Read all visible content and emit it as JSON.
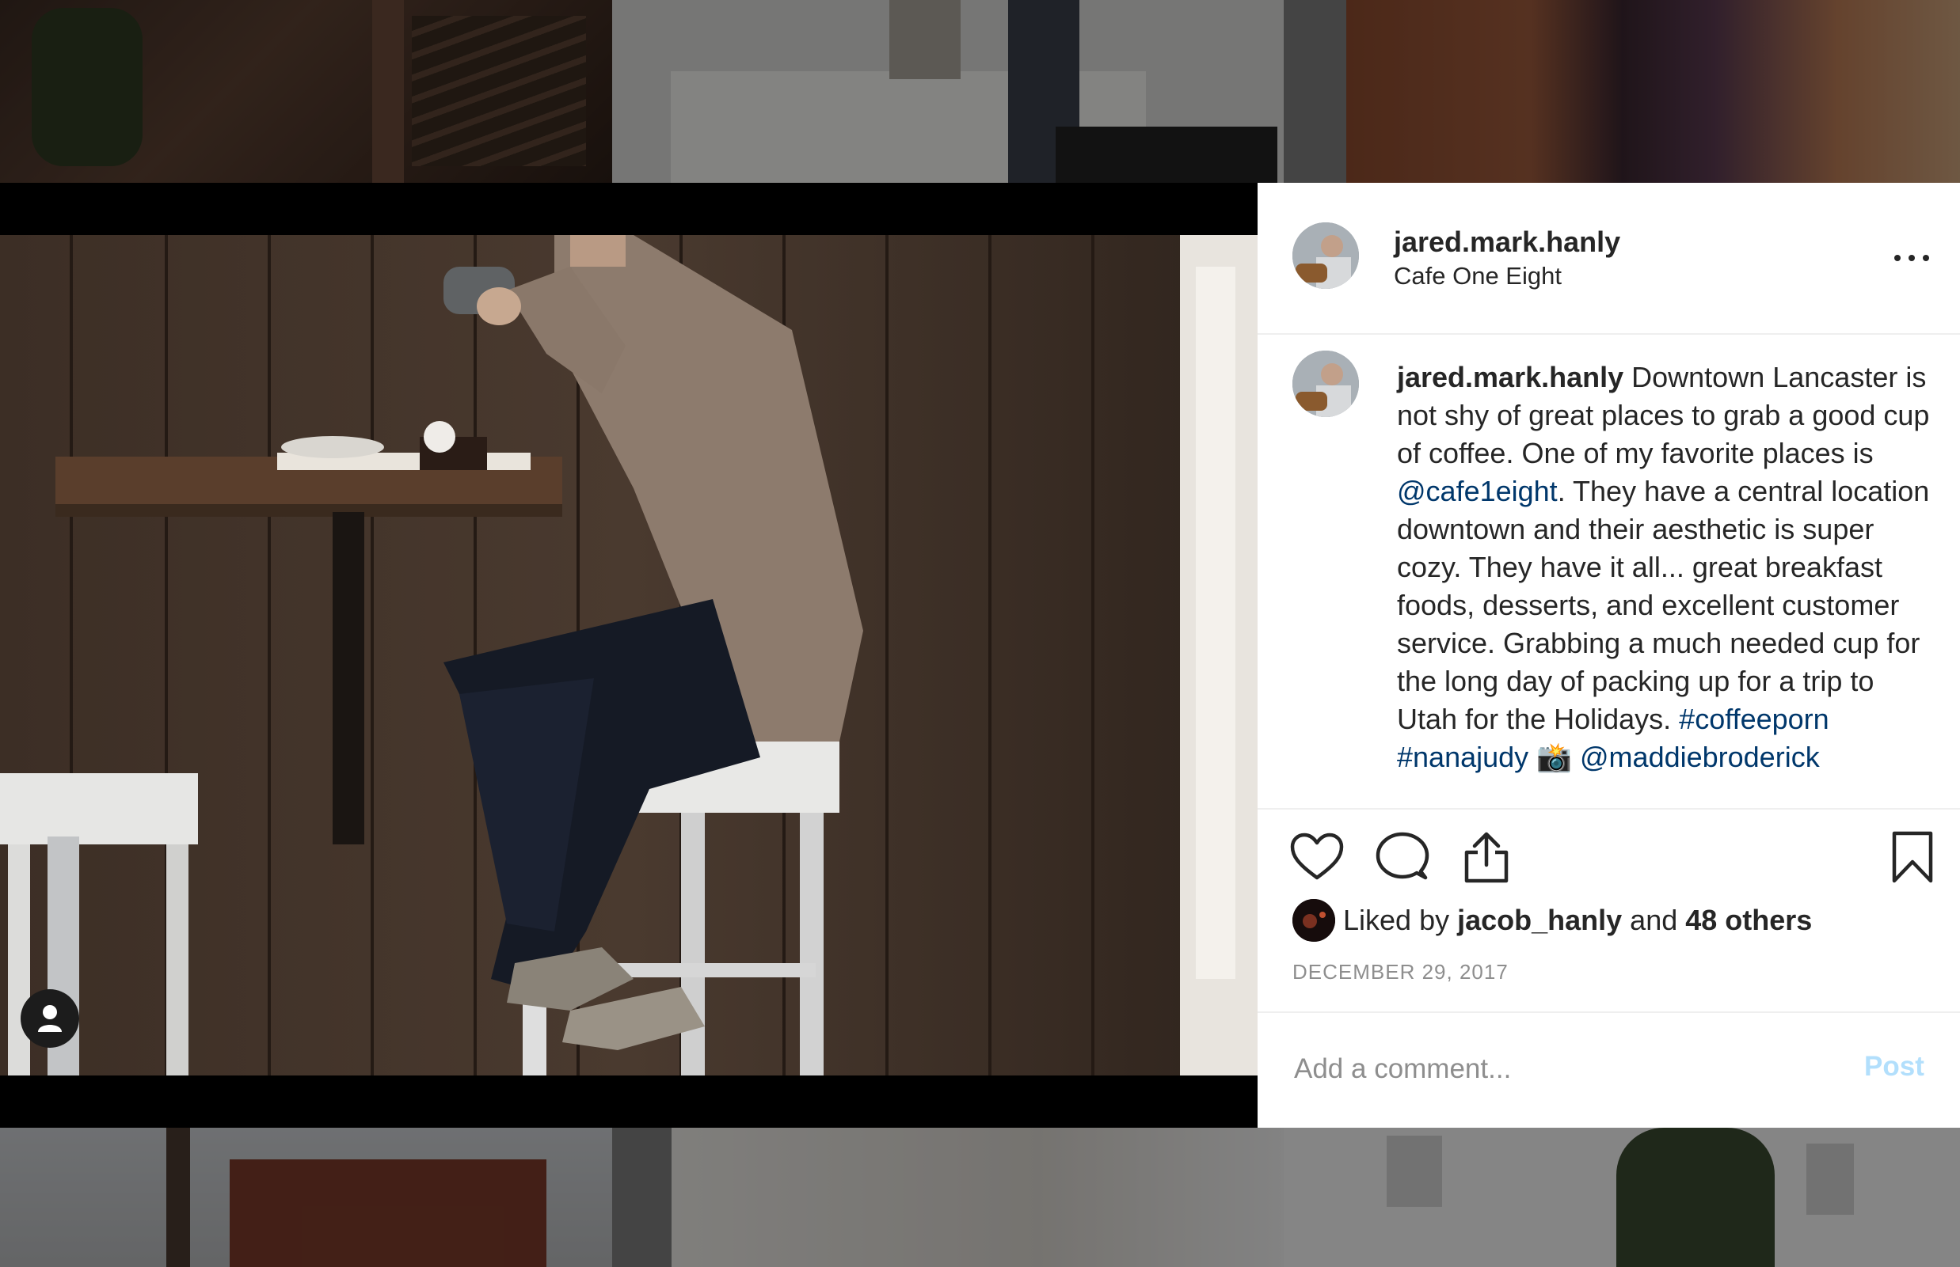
{
  "post": {
    "username": "jared.mark.hanly",
    "location": "Cafe One Eight",
    "caption_parts": {
      "username": "jared.mark.hanly",
      "text1": " Downtown Lancaster is not shy of great places to grab a good cup of coffee. One of my favorite places is ",
      "mention1": "@cafe1eight",
      "text2": ". They have a central location downtown and their aesthetic is super cozy. They have it all... great breakfast foods, desserts, and excellent customer service. Grabbing a much needed cup for the long day of packing up for a trip to Utah for the Holidays. ",
      "hashtag1": "#coffeeporn",
      "hashtag2": "#nanajudy",
      "emoji": "📸",
      "mention2": "@maddiebroderick"
    },
    "likes": {
      "prefix": "Liked by ",
      "user": "jacob_hanly",
      "middle": " and ",
      "others": "48 others"
    },
    "date": "DECEMBER 29, 2017"
  },
  "comment": {
    "placeholder": "Add a comment...",
    "post_label": "Post"
  },
  "icons": {
    "more": "more-options-icon",
    "like": "heart-icon",
    "comment": "comment-bubble-icon",
    "share": "share-icon",
    "save": "bookmark-icon",
    "tag": "user-tag-icon"
  },
  "colors": {
    "link": "#00376b",
    "text": "#262626",
    "muted": "#8e8e8e",
    "post_button_disabled": "#b2dffc"
  }
}
